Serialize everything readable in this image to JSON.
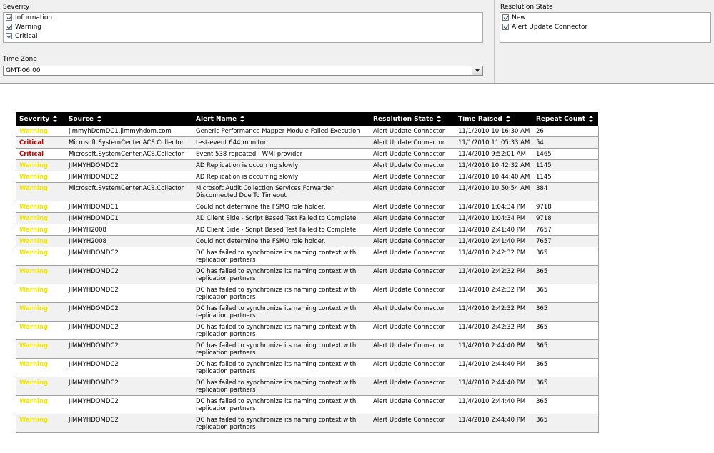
{
  "parameters": {
    "severity": {
      "label": "Severity",
      "options": [
        {
          "label": "Information",
          "checked": true
        },
        {
          "label": "Warning",
          "checked": true
        },
        {
          "label": "Critical",
          "checked": true
        }
      ]
    },
    "resolution_state": {
      "label": "Resolution State",
      "options": [
        {
          "label": "New",
          "checked": true
        },
        {
          "label": "Alert Update Connector",
          "checked": true
        }
      ]
    },
    "time_zone": {
      "label": "Time Zone",
      "selected": "GMT-06:00"
    }
  },
  "colors": {
    "header_bg": "#000000",
    "warning": "#f3e800",
    "critical": "#c00000"
  },
  "table": {
    "columns": [
      "Severity",
      "Source",
      "Alert Name",
      "Resolution State",
      "Time Raised",
      "Repeat Count"
    ],
    "rows": [
      [
        "Warning",
        "jimmyhDomDC1.jimmyhdom.com",
        "Generic Performance Mapper Module Failed Execution",
        "Alert Update Connector",
        "11/1/2010 10:16:30 AM",
        "26"
      ],
      [
        "Critical",
        "Microsoft.SystemCenter.ACS.Collector",
        "test-event 644 monitor",
        "Alert Update Connector",
        "11/1/2010 11:05:33 AM",
        "54"
      ],
      [
        "Critical",
        "Microsoft.SystemCenter.ACS.Collector",
        "Event 538 repeated - WMI provider",
        "Alert Update Connector",
        "11/4/2010 9:52:01 AM",
        "1465"
      ],
      [
        "Warning",
        "JIMMYHDOMDC2",
        "AD Replication is occurring slowly",
        "Alert Update Connector",
        "11/4/2010 10:42:32 AM",
        "1145"
      ],
      [
        "Warning",
        "JIMMYHDOMDC2",
        "AD Replication is occurring slowly",
        "Alert Update Connector",
        "11/4/2010 10:44:40 AM",
        "1145"
      ],
      [
        "Warning",
        "Microsoft.SystemCenter.ACS.Collector",
        "Microsoft Audit Collection Services Forwarder Disconnected Due To Timeout",
        "Alert Update Connector",
        "11/4/2010 10:50:54 AM",
        "384"
      ],
      [
        "Warning",
        "JIMMYHDOMDC1",
        "Could not determine the FSMO role holder.",
        "Alert Update Connector",
        "11/4/2010 1:04:34 PM",
        "9718"
      ],
      [
        "Warning",
        "JIMMYHDOMDC1",
        "AD Client Side - Script Based Test Failed to Complete",
        "Alert Update Connector",
        "11/4/2010 1:04:34 PM",
        "9718"
      ],
      [
        "Warning",
        "JIMMYH2008",
        "AD Client Side - Script Based Test Failed to Complete",
        "Alert Update Connector",
        "11/4/2010 2:41:40 PM",
        "7657"
      ],
      [
        "Warning",
        "JIMMYH2008",
        "Could not determine the FSMO role holder.",
        "Alert Update Connector",
        "11/4/2010 2:41:40 PM",
        "7657"
      ],
      [
        "Warning",
        "JIMMYHDOMDC2",
        "DC has failed to synchronize its naming context with replication partners",
        "Alert Update Connector",
        "11/4/2010 2:42:32 PM",
        "365"
      ],
      [
        "Warning",
        "JIMMYHDOMDC2",
        "DC has failed to synchronize its naming context with replication partners",
        "Alert Update Connector",
        "11/4/2010 2:42:32 PM",
        "365"
      ],
      [
        "Warning",
        "JIMMYHDOMDC2",
        "DC has failed to synchronize its naming context with replication partners",
        "Alert Update Connector",
        "11/4/2010 2:42:32 PM",
        "365"
      ],
      [
        "Warning",
        "JIMMYHDOMDC2",
        "DC has failed to synchronize its naming context with replication partners",
        "Alert Update Connector",
        "11/4/2010 2:42:32 PM",
        "365"
      ],
      [
        "Warning",
        "JIMMYHDOMDC2",
        "DC has failed to synchronize its naming context with replication partners",
        "Alert Update Connector",
        "11/4/2010 2:42:32 PM",
        "365"
      ],
      [
        "Warning",
        "JIMMYHDOMDC2",
        "DC has failed to synchronize its naming context with replication partners",
        "Alert Update Connector",
        "11/4/2010 2:44:40 PM",
        "365"
      ],
      [
        "Warning",
        "JIMMYHDOMDC2",
        "DC has failed to synchronize its naming context with replication partners",
        "Alert Update Connector",
        "11/4/2010 2:44:40 PM",
        "365"
      ],
      [
        "Warning",
        "JIMMYHDOMDC2",
        "DC has failed to synchronize its naming context with replication partners",
        "Alert Update Connector",
        "11/4/2010 2:44:40 PM",
        "365"
      ],
      [
        "Warning",
        "JIMMYHDOMDC2",
        "DC has failed to synchronize its naming context with replication partners",
        "Alert Update Connector",
        "11/4/2010 2:44:40 PM",
        "365"
      ],
      [
        "Warning",
        "JIMMYHDOMDC2",
        "DC has failed to synchronize its naming context with replication partners",
        "Alert Update Connector",
        "11/4/2010 2:44:40 PM",
        "365"
      ]
    ]
  }
}
